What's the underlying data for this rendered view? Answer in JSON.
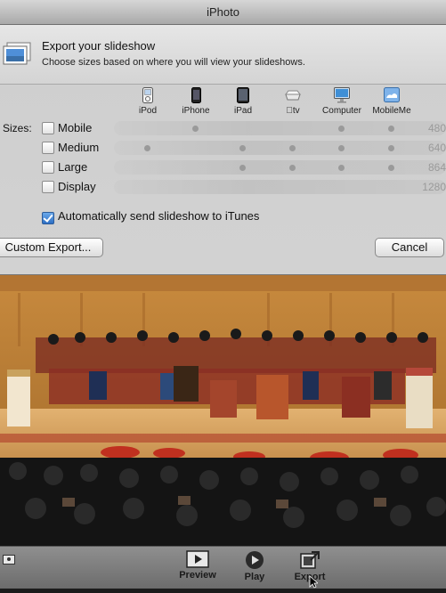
{
  "window": {
    "title": "iPhoto"
  },
  "sheet": {
    "icon": "slideshow-export-icon",
    "title": "Export your slideshow",
    "subtitle": "Choose sizes based on where you will view your slideshows."
  },
  "devices": [
    {
      "label": "iPod",
      "icon": "ipod-icon"
    },
    {
      "label": "iPhone",
      "icon": "iphone-icon"
    },
    {
      "label": "iPad",
      "icon": "ipad-icon"
    },
    {
      "label": "tv",
      "icon": "apple-tv-icon"
    },
    {
      "label": "Computer",
      "icon": "computer-icon"
    },
    {
      "label": "MobileMe",
      "icon": "mobileme-icon"
    }
  ],
  "sizes": {
    "label": "Sizes:",
    "rows": [
      {
        "label": "Mobile",
        "size": "480",
        "checked": false
      },
      {
        "label": "Medium",
        "size": "640",
        "checked": false
      },
      {
        "label": "Large",
        "size": "864",
        "checked": false
      },
      {
        "label": "Display",
        "size": "1280",
        "checked": false
      }
    ]
  },
  "auto_send": {
    "label": "Automatically send slideshow to iTunes",
    "checked": true
  },
  "buttons": {
    "custom_export": "Custom Export...",
    "cancel": "Cancel"
  },
  "toolbar": {
    "preview": "Preview",
    "play": "Play",
    "export": "Export"
  }
}
